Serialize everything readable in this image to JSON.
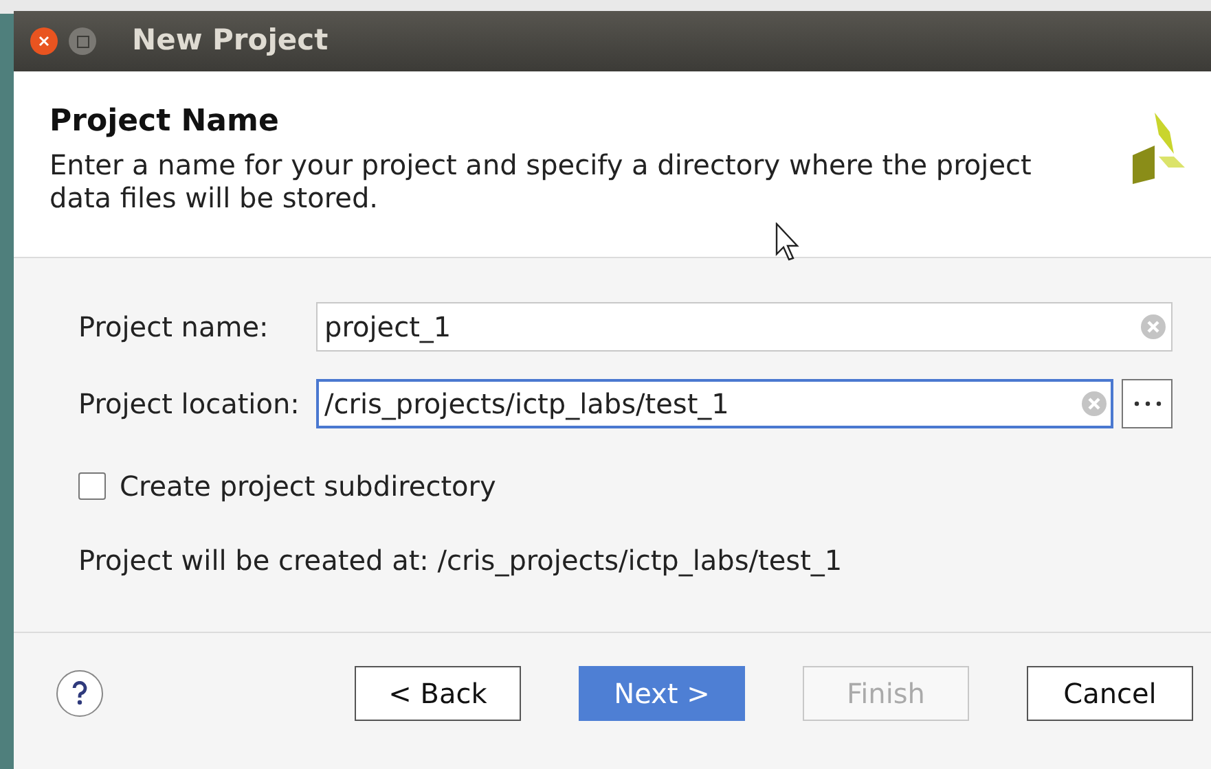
{
  "window": {
    "title": "New Project"
  },
  "header": {
    "title": "Project Name",
    "description": "Enter a name for your project and specify a directory where the project data files will be stored."
  },
  "fields": [
    {
      "label": "Project name:",
      "value": "project_1",
      "focused": false,
      "browse": false
    },
    {
      "label": "Project location:",
      "value": "/cris_projects/ictp_labs/test_1",
      "focused": true,
      "browse": true
    }
  ],
  "subdirectory": {
    "label": "Create project subdirectory",
    "checked": false
  },
  "summary": "Project will be created at: /cris_projects/ictp_labs/test_1",
  "buttons": [
    {
      "label": "< Back",
      "kind": "normal",
      "disabled": false
    },
    {
      "label": "Next >",
      "kind": "default",
      "disabled": false
    },
    {
      "label": "Finish",
      "kind": "normal",
      "disabled": true
    },
    {
      "label": "Cancel",
      "kind": "normal",
      "disabled": false
    }
  ]
}
